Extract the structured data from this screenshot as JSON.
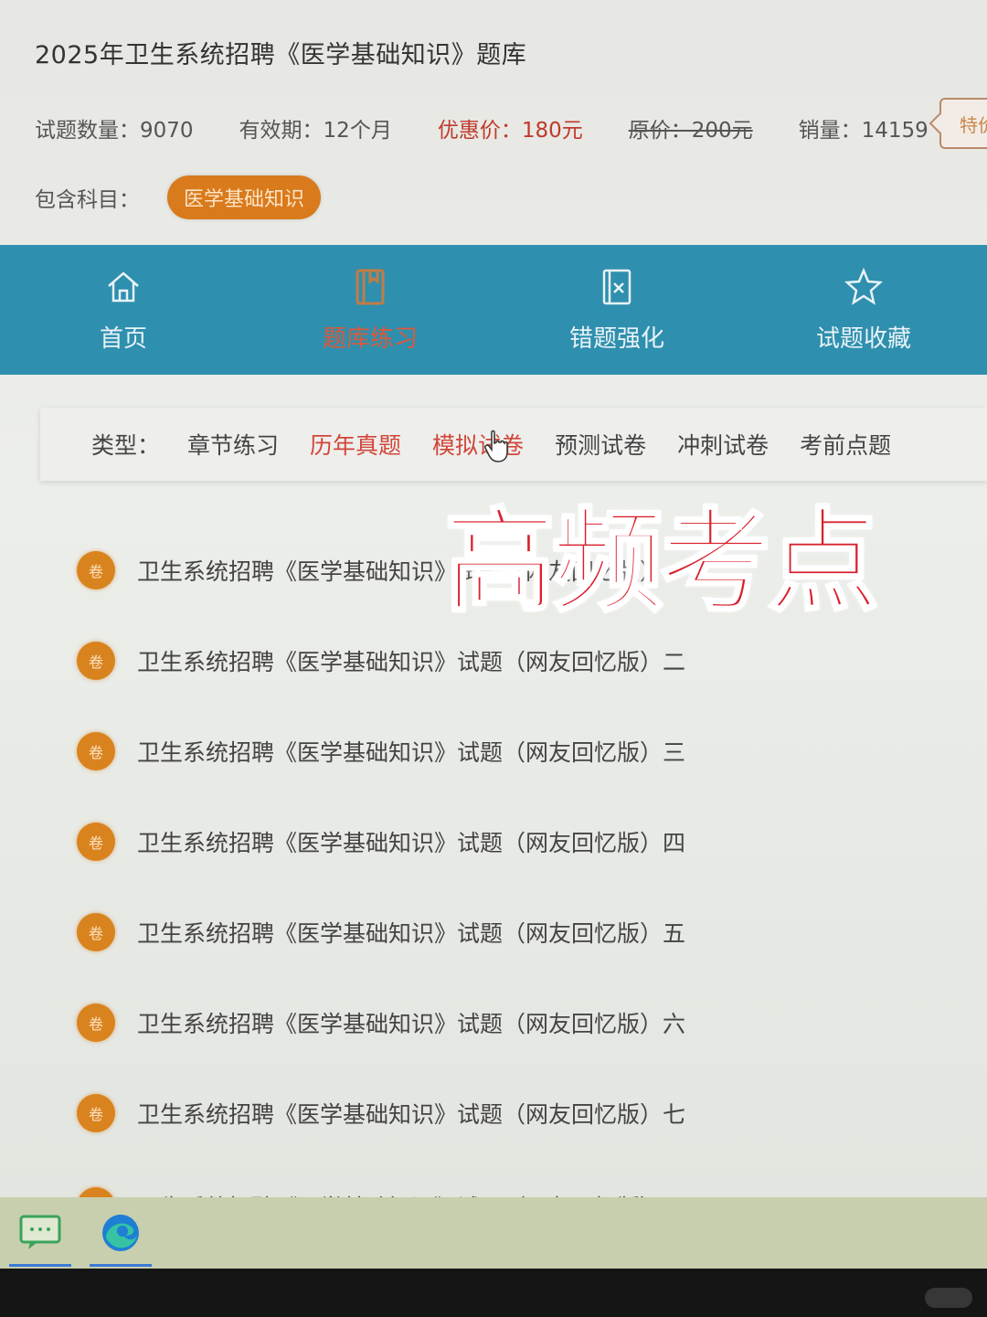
{
  "header": {
    "title": "2025年卫生系统招聘《医学基础知识》题库",
    "count": "试题数量：9070",
    "validity": "有效期：12个月",
    "sale_price": "优惠价：180元",
    "orig_price": "原价：200元",
    "sales": "销量：14159",
    "special": "特价"
  },
  "subjects": {
    "label": "包含科目：",
    "items": [
      "医学基础知识"
    ]
  },
  "nav": {
    "items": [
      {
        "label": "首页",
        "icon": "home-icon"
      },
      {
        "label": "题库练习",
        "icon": "book-icon"
      },
      {
        "label": "错题强化",
        "icon": "wrong-question-icon"
      },
      {
        "label": "试题收藏",
        "icon": "star-icon"
      }
    ]
  },
  "types": {
    "label": "类型：",
    "tabs": [
      "章节练习",
      "历年真题",
      "模拟试卷",
      "预测试卷",
      "冲刺试卷",
      "考前点题"
    ]
  },
  "list": {
    "badge": "卷",
    "items": [
      "卫生系统招聘《医学基础知识》试题（网友回忆版）一",
      "卫生系统招聘《医学基础知识》试题（网友回忆版）二",
      "卫生系统招聘《医学基础知识》试题（网友回忆版）三",
      "卫生系统招聘《医学基础知识》试题（网友回忆版）四",
      "卫生系统招聘《医学基础知识》试题（网友回忆版）五",
      "卫生系统招聘《医学基础知识》试题（网友回忆版）六",
      "卫生系统招聘《医学基础知识》试题（网友回忆版）七",
      "卫生系统招聘《医学基础知识》试题（网友回忆版）八"
    ]
  },
  "overlay": {
    "text": "高频考点"
  },
  "colors": {
    "nav_bg": "#2f8fae",
    "accent_orange": "#d9831f",
    "sale_red": "#c0392b",
    "overlay_red": "#d8202c"
  },
  "taskbar": {
    "apps": [
      "chat-app-icon",
      "edge-browser-icon"
    ]
  }
}
